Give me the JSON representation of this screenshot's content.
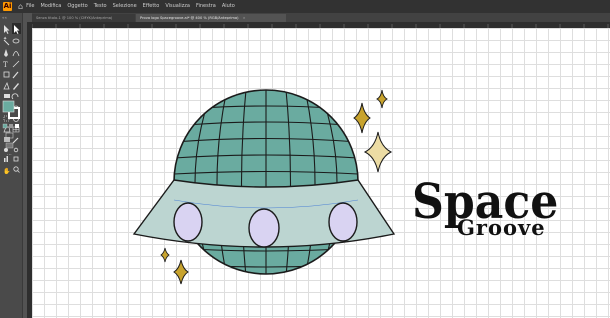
{
  "app": {
    "logo_text": "Ai"
  },
  "menu": {
    "items": [
      "File",
      "Modifica",
      "Oggetto",
      "Testo",
      "Selezione",
      "Effetto",
      "Visualizza",
      "Finestra",
      "Aiuto"
    ]
  },
  "tabs": [
    {
      "label": "Senza titolo-1 @ 100 % (CMYK/Anteprima)"
    },
    {
      "label": "Prova logo Spacegroove.ai* @ 400 % (RGB/Anteprima)"
    }
  ],
  "artwork": {
    "title_line1": "Space",
    "title_line2": "Groove",
    "colors": {
      "planet": "#6aaba0",
      "saucer": "#bcd5d1",
      "window": "#d9d3f2",
      "sparkle_gold": "#c8a32d",
      "sparkle_light": "#ecdca4",
      "outline": "#1b1b1b"
    }
  },
  "tools": [
    "selection-tool",
    "direct-selection-tool",
    "magic-wand-tool",
    "lasso-tool",
    "pen-tool",
    "curvature-tool",
    "type-tool",
    "line-tool",
    "rectangle-tool",
    "paintbrush-tool",
    "shaper-tool",
    "pencil-tool",
    "eraser-tool",
    "rotate-tool",
    "scale-tool",
    "width-tool",
    "free-transform-tool",
    "shape-builder-tool",
    "perspective-grid-tool",
    "mesh-tool",
    "gradient-tool",
    "eyedropper-tool",
    "blend-tool",
    "symbol-sprayer-tool",
    "column-graph-tool",
    "artboard-tool",
    "slice-tool",
    "hand-tool",
    "zoom-tool"
  ]
}
